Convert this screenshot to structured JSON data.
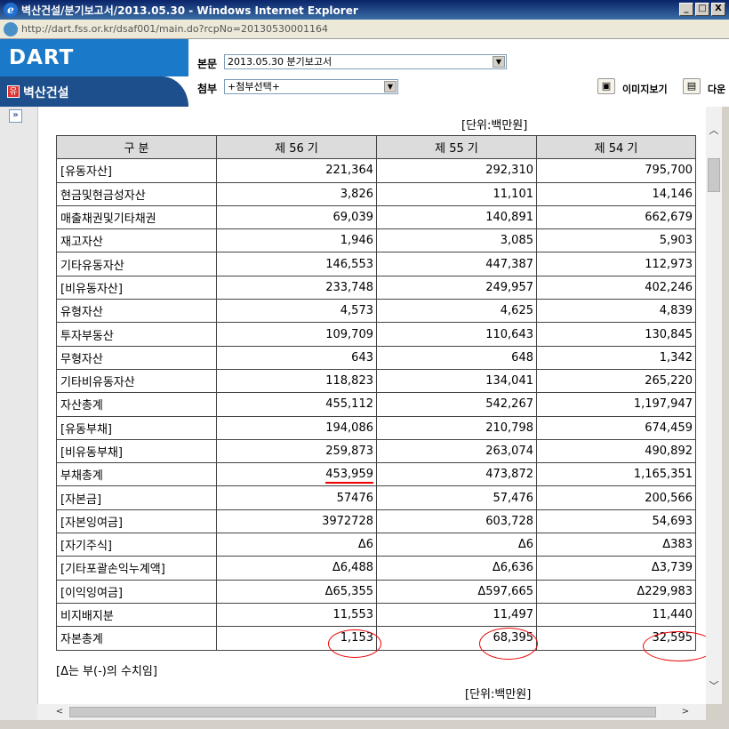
{
  "window": {
    "title": "벽산건설/분기보고서/2013.05.30 - Windows Internet Explorer",
    "minimize": "_",
    "maximize": "□",
    "close": "X"
  },
  "address": {
    "url": "http://dart.fss.or.kr/dsaf001/main.do?rcpNo=20130530001164"
  },
  "header": {
    "logo": "DART",
    "company_badge": "유",
    "company": "벽산건설",
    "main_label": "본문",
    "main_value": "2013.05.30  분기보고서",
    "attach_label": "첨부",
    "attach_value": "+첨부선택+",
    "image_view": "이미지보기",
    "download": "다운"
  },
  "sidebar": {
    "toggle": "»"
  },
  "table": {
    "unit": "[단위:백만원]",
    "headers": [
      "구 분",
      "제 56 기",
      "제 55 기",
      "제 54 기"
    ],
    "rows": [
      [
        "[유동자산]",
        "221,364",
        "292,310",
        "795,700"
      ],
      [
        "현금및현금성자산",
        "3,826",
        "11,101",
        "14,146"
      ],
      [
        "매출채권및기타채권",
        "69,039",
        "140,891",
        "662,679"
      ],
      [
        "재고자산",
        "1,946",
        "3,085",
        "5,903"
      ],
      [
        "기타유동자산",
        "146,553",
        "447,387",
        "112,973"
      ],
      [
        "[비유동자산]",
        "233,748",
        "249,957",
        "402,246"
      ],
      [
        "유형자산",
        "4,573",
        "4,625",
        "4,839"
      ],
      [
        "투자부동산",
        "109,709",
        "110,643",
        "130,845"
      ],
      [
        "무형자산",
        "643",
        "648",
        "1,342"
      ],
      [
        "기타비유동자산",
        "118,823",
        "134,041",
        "265,220"
      ],
      [
        "자산총계",
        "455,112",
        "542,267",
        "1,197,947"
      ],
      [
        "[유동부채]",
        "194,086",
        "210,798",
        "674,459"
      ],
      [
        "[비유동부채]",
        "259,873",
        "263,074",
        "490,892"
      ],
      [
        "부채총계",
        "453,959",
        "473,872",
        "1,165,351"
      ],
      [
        "[자본금]",
        "57476",
        "57,476",
        "200,566"
      ],
      [
        "[자본잉여금]",
        "3972728",
        "603,728",
        "54,693"
      ],
      [
        "[자기주식]",
        "Δ6",
        "Δ6",
        "Δ383"
      ],
      [
        "[기타포괄손익누계액]",
        "Δ6,488",
        "Δ6,636",
        "Δ3,739"
      ],
      [
        "[이익잉여금]",
        "Δ65,355",
        "Δ597,665",
        "Δ229,983"
      ],
      [
        "비지배지분",
        "11,553",
        "11,497",
        "11,440"
      ],
      [
        "자본총계",
        "1,153",
        "68,395",
        "32,595"
      ]
    ],
    "note": "[Δ는 부(-)의 수치임]",
    "unit_next": "[단위:백만원]"
  }
}
